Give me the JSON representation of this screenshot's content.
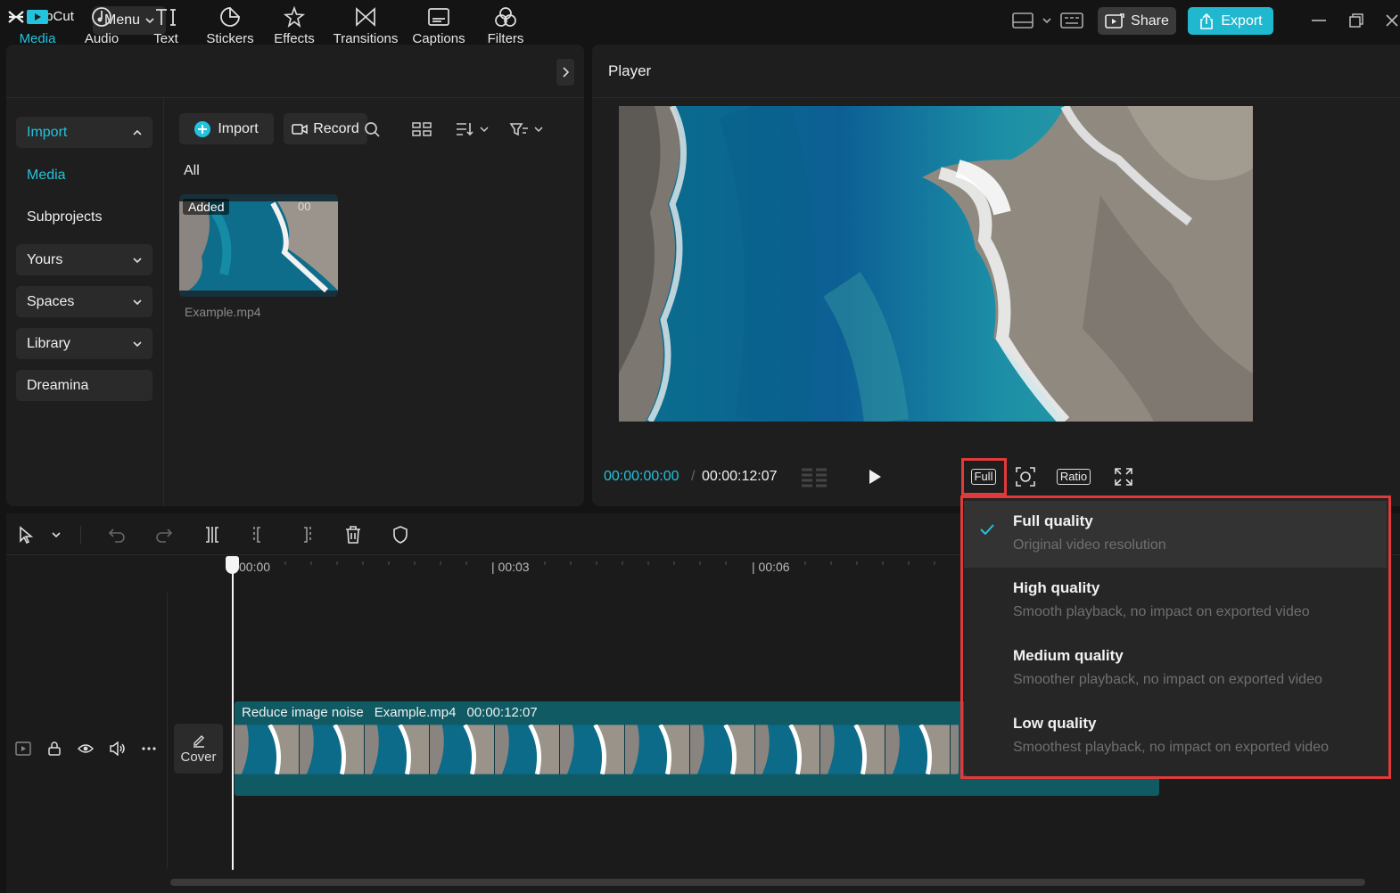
{
  "titlebar": {
    "app_name": "CapCut",
    "menu_label": "Menu",
    "share_label": "Share",
    "export_label": "Export"
  },
  "toolbar": {
    "tabs": [
      {
        "label": "Media",
        "icon": "media-icon",
        "active": true
      },
      {
        "label": "Audio",
        "icon": "audio-icon"
      },
      {
        "label": "Text",
        "icon": "text-icon"
      },
      {
        "label": "Stickers",
        "icon": "stickers-icon"
      },
      {
        "label": "Effects",
        "icon": "effects-icon"
      },
      {
        "label": "Transitions",
        "icon": "transitions-icon"
      },
      {
        "label": "Captions",
        "icon": "captions-icon"
      },
      {
        "label": "Filters",
        "icon": "filters-icon"
      }
    ]
  },
  "sidebar": {
    "items": [
      {
        "label": "Import",
        "style": "cyan-boxed",
        "caret": "up"
      },
      {
        "label": "Media",
        "style": "cyan"
      },
      {
        "label": "Subprojects",
        "style": "plain"
      },
      {
        "label": "Yours",
        "style": "boxed",
        "caret": "down"
      },
      {
        "label": "Spaces",
        "style": "boxed",
        "caret": "down"
      },
      {
        "label": "Library",
        "style": "boxed",
        "caret": "down"
      },
      {
        "label": "Dreamina",
        "style": "boxed"
      }
    ]
  },
  "media": {
    "import_label": "Import",
    "record_label": "Record",
    "filter_all": "All",
    "item": {
      "badge": "Added",
      "duration": "00",
      "filename": "Example.mp4"
    }
  },
  "player": {
    "title": "Player",
    "timecode_current": "00:00:00:00",
    "timecode_separator": "/",
    "timecode_total": "00:00:12:07",
    "quality_button": "Full",
    "ratio_button": "Ratio"
  },
  "timeline": {
    "ruler": [
      "00:00",
      "| 00:03",
      "| 00:06"
    ],
    "cover_label": "Cover",
    "clip": {
      "effect": "Reduce image noise",
      "name": "Example.mp4",
      "duration": "00:00:12:07"
    }
  },
  "quality_menu": {
    "items": [
      {
        "title": "Full quality",
        "desc": "Original video resolution",
        "selected": true
      },
      {
        "title": "High quality",
        "desc": "Smooth playback, no impact on exported video"
      },
      {
        "title": "Medium quality",
        "desc": "Smoother playback, no impact on exported video"
      },
      {
        "title": "Low quality",
        "desc": "Smoothest playback, no impact on exported video"
      }
    ]
  },
  "colors": {
    "accent": "#22c3dc",
    "export": "#1fb8cf",
    "highlight": "#e03a3a",
    "clip": "#0f5a63"
  }
}
